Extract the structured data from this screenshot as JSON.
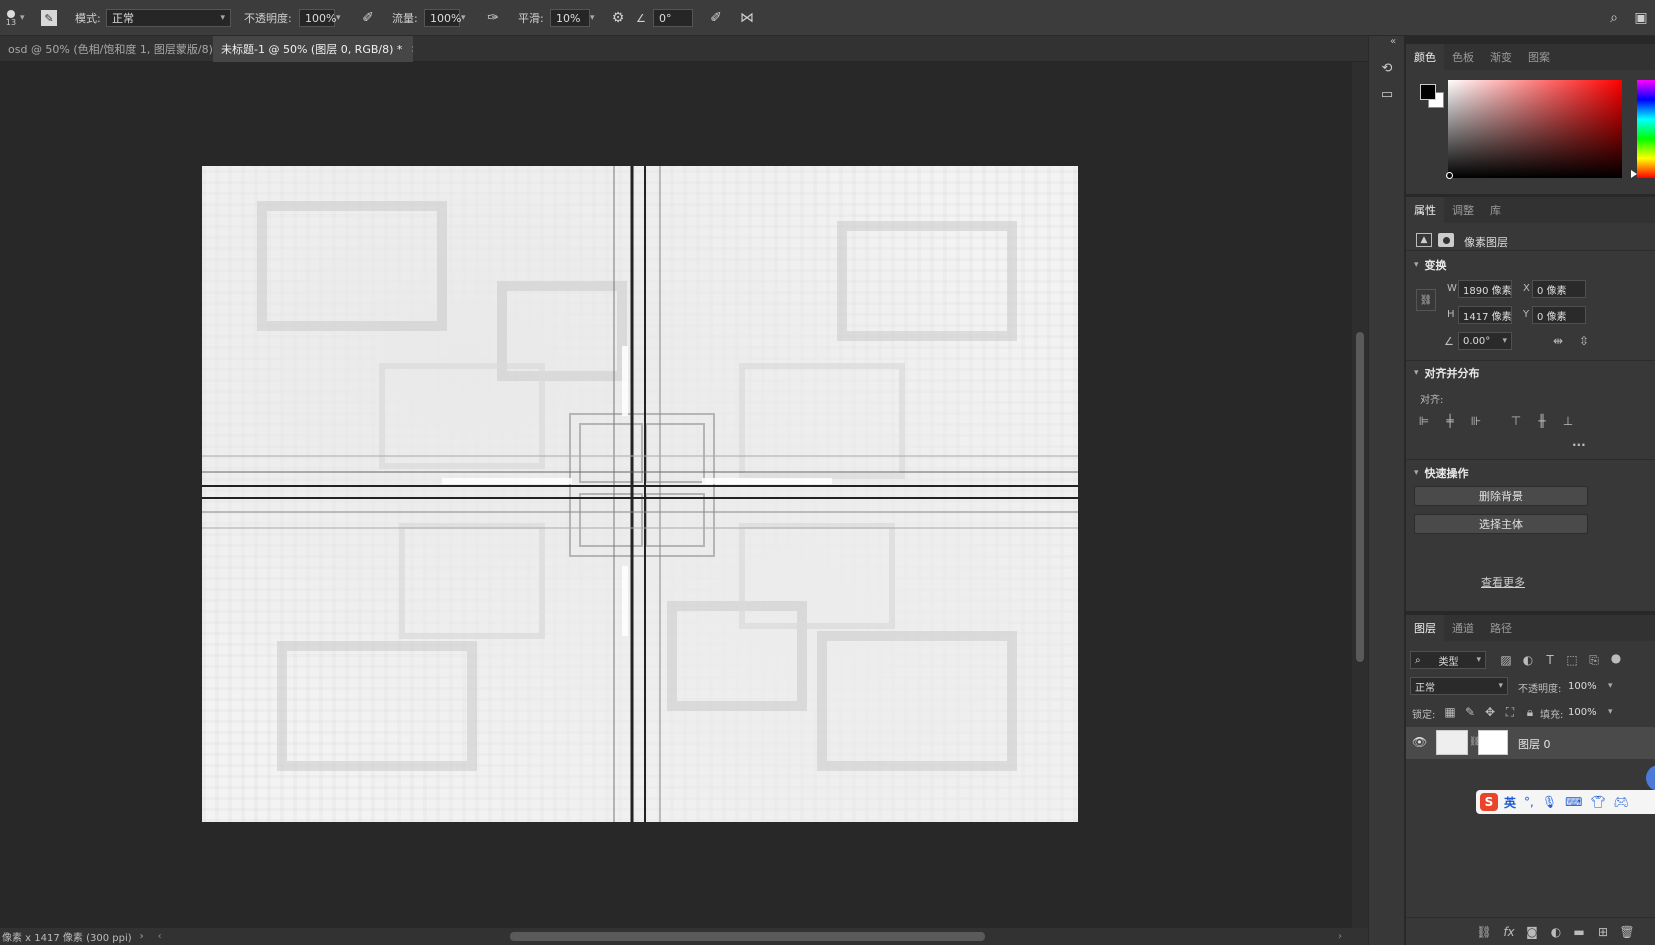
{
  "options_bar": {
    "brush_size": "13",
    "mode_label": "模式:",
    "mode_value": "正常",
    "opacity_label": "不透明度:",
    "opacity_value": "100%",
    "flow_label": "流量:",
    "flow_value": "100%",
    "smooth_label": "平滑:",
    "smooth_value": "10%",
    "angle_value": "0°"
  },
  "tabs": [
    {
      "label": "osd @ 50% (色相/饱和度 1, 图层蒙版/8)",
      "active": false
    },
    {
      "label": "未标题-1 @ 50% (图层 0, RGB/8) *",
      "active": true
    }
  ],
  "status": {
    "doc_info": "像素 x 1417 像素 (300 ppi)"
  },
  "color_panel": {
    "tabs": [
      "颜色",
      "色板",
      "渐变",
      "图案"
    ],
    "colors": {
      "foreground": "#000000",
      "background": "#ffffff",
      "hue": "#ff0000"
    }
  },
  "properties": {
    "tabs": [
      "属性",
      "调整",
      "库"
    ],
    "layer_type": "像素图层",
    "transform_title": "变换",
    "w_label": "W",
    "w_value": "1890 像素",
    "h_label": "H",
    "h_value": "1417 像素",
    "x_label": "X",
    "x_value": "0 像素",
    "y_label": "Y",
    "y_value": "0 像素",
    "angle_value": "0.00°",
    "align_title": "对齐并分布",
    "align_label": "对齐:",
    "more_dots": "...",
    "quick_title": "快速操作",
    "remove_bg": "删除背景",
    "select_subject": "选择主体",
    "see_more": "查看更多"
  },
  "layers": {
    "tabs": [
      "图层",
      "通道",
      "路径"
    ],
    "filter_value": "类型",
    "blend_value": "正常",
    "opacity_label": "不透明度:",
    "opacity_value": "100%",
    "lock_label": "锁定:",
    "fill_label": "填充:",
    "fill_value": "100%",
    "items": [
      {
        "name": "图层 0",
        "visible": true
      }
    ]
  },
  "ime": {
    "lang": "英"
  }
}
